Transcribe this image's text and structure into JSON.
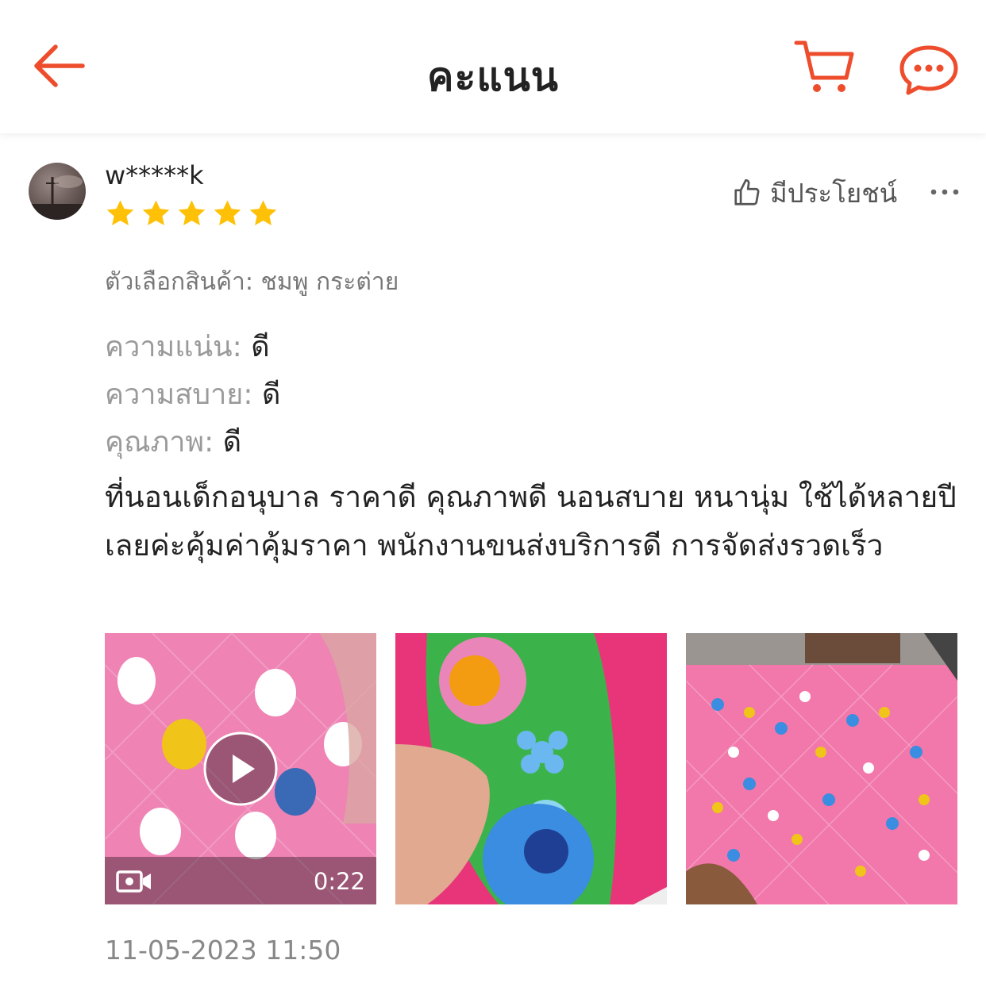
{
  "header": {
    "title": "คะแนน",
    "back_icon": "arrow-left-icon",
    "cart_icon": "cart-icon",
    "chat_icon": "chat-icon",
    "accent_color": "#ee4d2d"
  },
  "review": {
    "username": "w*****k",
    "rating": 5,
    "rating_max": 5,
    "star_color": "#ffc107",
    "helpful_label": "มีประโยชน์",
    "variation": "ตัวเลือกสินค้า: ชมพู กระต่าย",
    "attributes": [
      {
        "label": "ความแน่น:",
        "value": "ดี"
      },
      {
        "label": "ความสบาย:",
        "value": "ดี"
      },
      {
        "label": "คุณภาพ:",
        "value": "ดี"
      }
    ],
    "text": "ที่นอนเด็กอนุบาล ราคาดี คุณภาพดี นอนสบาย หนานุ่ม ใช้ได้หลายปีเลยค่ะคุ้มค่าคุ้มราคา พนักงานขนส่งบริการดี การจัดส่งรวดเร็ว",
    "media": {
      "video_duration": "0:22"
    },
    "timestamp": "11-05-2023 11:50"
  }
}
